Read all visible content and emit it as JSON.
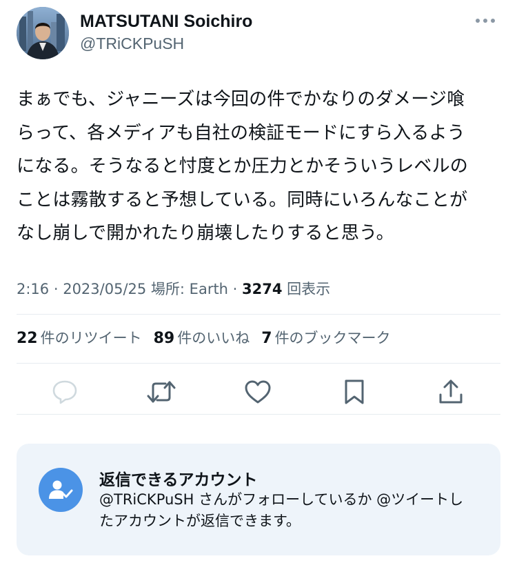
{
  "author": {
    "name": "MATSUTANI Soichiro",
    "handle": "@TRiCKPuSH"
  },
  "tweet": {
    "lines": [
      "まぁでも、ジャニーズは今回の件でかなりのダメージ喰",
      "らって、各メディアも自社の検証モードにすら入るよう",
      "になる。そうなると忖度とか圧力とかそういうレベルの",
      "ことは霧散すると予想している。同時にいろんなことが",
      "なし崩しで開かれたり崩壊したりすると思う。"
    ]
  },
  "meta": {
    "time": "2:16",
    "sep1": " · ",
    "date": "2023/05/25",
    "location": " 場所: Earth",
    "sep2": " · ",
    "views_count": "3274",
    "views_label": " 回表示"
  },
  "stats": {
    "retweets_count": "22",
    "retweets_label": "件のリツイート",
    "likes_count": "89",
    "likes_label": "件のいいね",
    "bookmarks_count": "7",
    "bookmarks_label": "件のブックマーク"
  },
  "actions": [
    "reply-icon",
    "retweet-icon",
    "heart-icon",
    "bookmark-icon",
    "share-icon"
  ],
  "reply_restriction": {
    "title": "返信できるアカウント",
    "description": "@TRiCKPuSH さんがフォローしているか @ツイートしたアカウントが返信できます。"
  },
  "colors": {
    "primary_text": "#0f1419",
    "secondary_text": "#536471",
    "icon_gray": "#536471",
    "accent_blue": "#4b93e6",
    "card_bg": "#eef4fa",
    "divider": "#e6ecf0"
  }
}
